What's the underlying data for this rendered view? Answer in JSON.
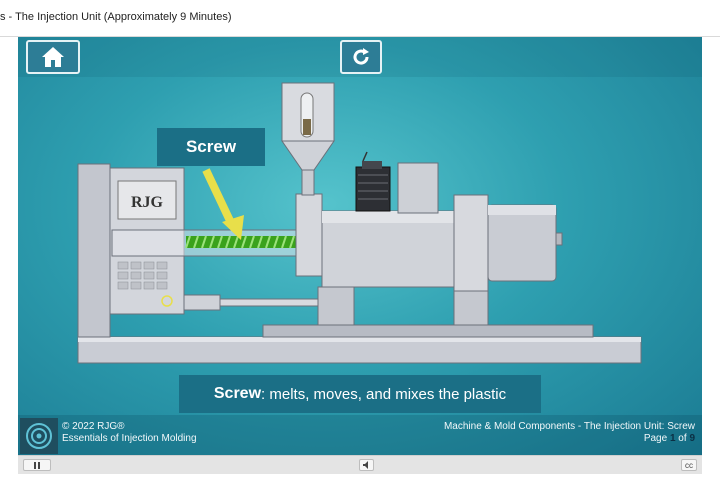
{
  "window": {
    "title": "s - The Injection Unit (Approximately 9 Minutes)"
  },
  "nav": {
    "home_icon": "home-icon",
    "replay_icon": "replay-icon"
  },
  "slide": {
    "callout_label": "Screw",
    "machine_logo_text": "RJG",
    "caption_bold": "Screw",
    "caption_rest": ": melts, moves, and mixes the plastic"
  },
  "footer": {
    "copyright": "© 2022 RJG®",
    "course_title": "Essentials of Injection Molding",
    "section": "Machine & Mold Components - The Injection Unit: Screw",
    "page_prefix": "Page ",
    "page_current": "1",
    "page_of": " of ",
    "page_total": "9"
  },
  "controls": {
    "pause_icon": "pause-icon",
    "audio_icon": "speaker-icon",
    "cc_label": "cc"
  },
  "colors": {
    "accent": "#1b6f86",
    "stage": "#2e9fb0",
    "screw": "#4fc22a",
    "arrow": "#e8df4a"
  }
}
